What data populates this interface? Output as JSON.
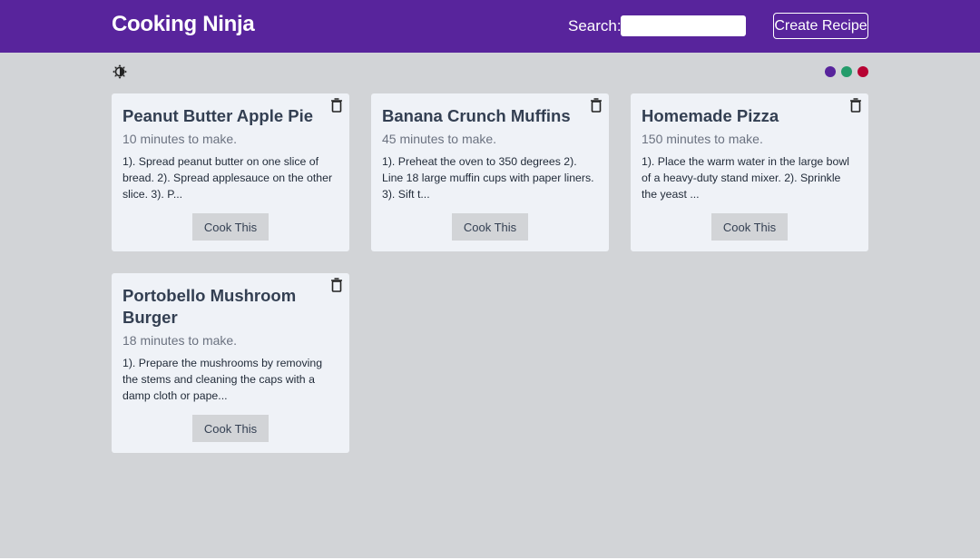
{
  "app": {
    "brand": "Cooking Ninja"
  },
  "header": {
    "search_label": "Search:",
    "search_value": "",
    "create_label": "Create Recipe"
  },
  "theme": {
    "mode_icon": "brightness-contrast-icon",
    "swatches": [
      {
        "name": "purple",
        "color": "#58249c"
      },
      {
        "name": "green",
        "color": "#249c6b"
      },
      {
        "name": "red",
        "color": "#b70233"
      }
    ]
  },
  "recipes": [
    {
      "title": "Peanut Butter Apple Pie",
      "time": "10 minutes to make.",
      "description": "1). Spread peanut butter on one slice of bread. 2). Spread applesauce on the other slice. 3). P...",
      "button": "Cook This"
    },
    {
      "title": "Banana Crunch Muffins",
      "time": "45 minutes to make.",
      "description": "1). Preheat the oven to 350 degrees 2). Line 18 large muffin cups with paper liners. 3). Sift t...",
      "button": "Cook This"
    },
    {
      "title": "Homemade Pizza",
      "time": "150 minutes to make.",
      "description": "1). Place the warm water in the large bowl of a heavy-duty stand mixer. 2). Sprinkle the yeast ...",
      "button": "Cook This"
    },
    {
      "title": "Portobello Mushroom Burger",
      "time": "18 minutes to make.",
      "description": "1). Prepare the mushrooms by removing the stems and cleaning the caps with a damp cloth or pape...",
      "button": "Cook This"
    }
  ]
}
